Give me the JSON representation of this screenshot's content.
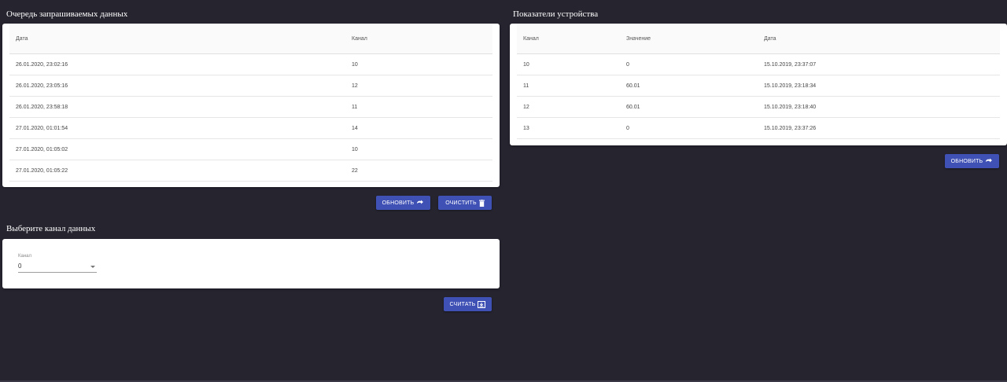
{
  "queue": {
    "title": "Очередь запрашиваемых данных",
    "columns": [
      "Дата",
      "Канал"
    ],
    "rows": [
      [
        "26.01.2020, 23:02:16",
        "10"
      ],
      [
        "26.01.2020, 23:05:16",
        "12"
      ],
      [
        "26.01.2020, 23:58:18",
        "11"
      ],
      [
        "27.01.2020, 01:01:54",
        "14"
      ],
      [
        "27.01.2020, 01:05:02",
        "10"
      ],
      [
        "27.01.2020, 01:05:22",
        "22"
      ]
    ],
    "refresh_label": "ОБНОВИТЬ",
    "clear_label": "ОЧИСТИТЬ"
  },
  "channel": {
    "title": "Выберите канал данных",
    "select_label": "Канал",
    "select_value": "0",
    "read_label": "СЧИТАТЬ"
  },
  "device": {
    "title": "Показатели устройства",
    "columns": [
      "Канал",
      "Значение",
      "Дата"
    ],
    "rows": [
      [
        "10",
        "0",
        "15.10.2019, 23:37:07"
      ],
      [
        "11",
        "60.01",
        "15.10.2019, 23:18:34"
      ],
      [
        "12",
        "60.01",
        "15.10.2019, 23:18:40"
      ],
      [
        "13",
        "0",
        "15.10.2019, 23:37:26"
      ]
    ],
    "refresh_label": "ОБНОВИТЬ"
  },
  "colors": {
    "background": "#26242f",
    "button": "#3f51b5",
    "card": "#ffffff"
  },
  "icons": {
    "refresh": "refresh-icon",
    "clear": "trash-icon",
    "read": "download-icon",
    "dropdown": "chevron-down-icon"
  }
}
